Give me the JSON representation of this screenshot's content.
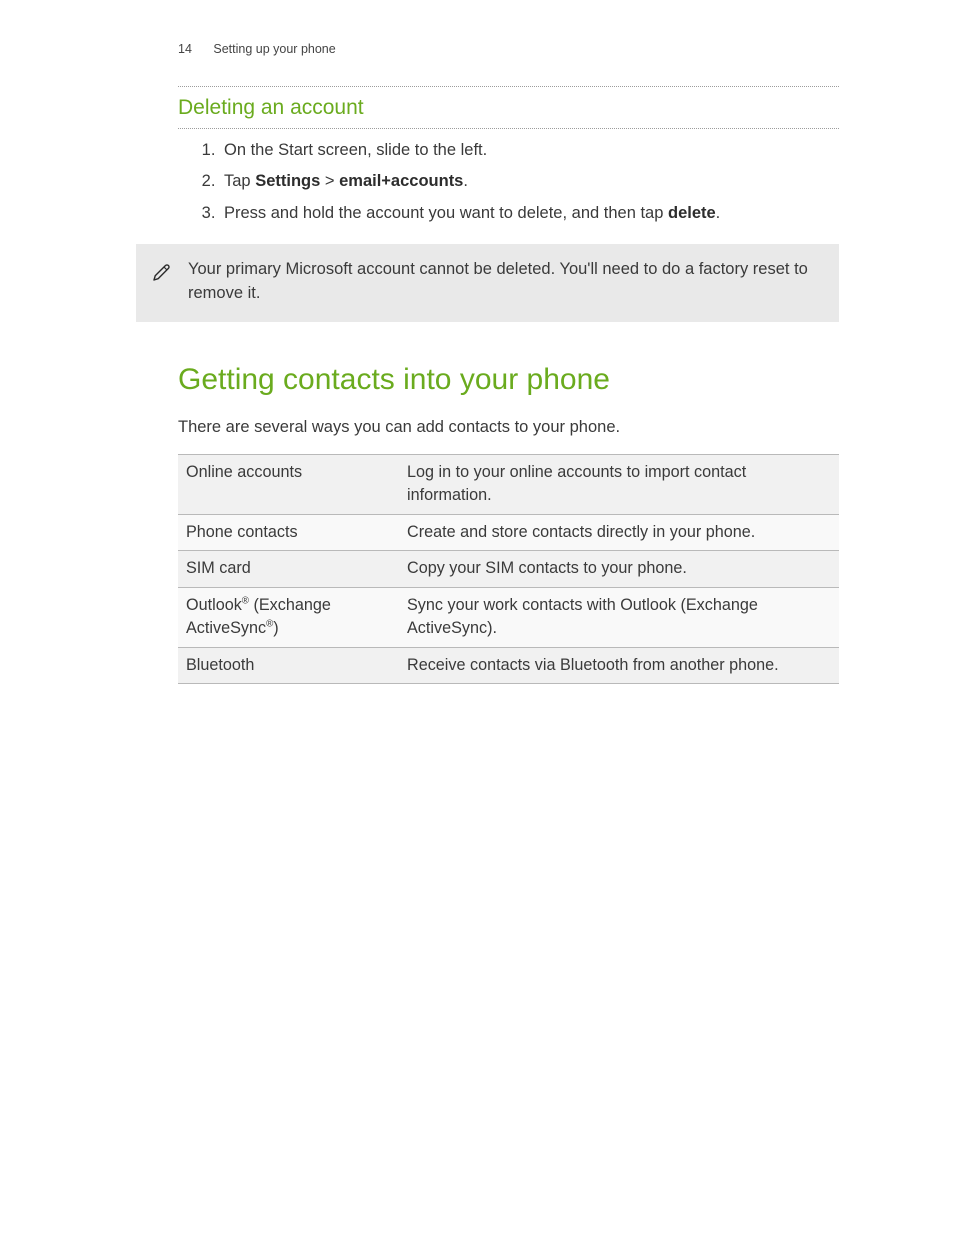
{
  "header": {
    "page_number": "14",
    "chapter": "Setting up your phone"
  },
  "section": {
    "title": "Deleting an account",
    "steps": {
      "s1": "On the Start screen, slide to the left.",
      "s2_pre": "Tap ",
      "s2_settings": "Settings",
      "s2_sep": " > ",
      "s2_email": "email+accounts",
      "s2_post": ".",
      "s3_pre": "Press and hold the account you want to delete, and then tap ",
      "s3_delete": "delete",
      "s3_post": "."
    }
  },
  "note": {
    "text": "Your primary Microsoft account cannot be deleted. You'll need to do a factory reset to remove it."
  },
  "main": {
    "title": "Getting contacts into your phone",
    "intro": "There are several ways you can add contacts to your phone.",
    "table": {
      "r0": {
        "left": "Online accounts",
        "right": "Log in to your online accounts to import contact information."
      },
      "r1": {
        "left": "Phone contacts",
        "right": "Create and store contacts directly in your phone."
      },
      "r2": {
        "left": "SIM card",
        "right": "Copy your SIM contacts to your phone."
      },
      "r3": {
        "left_a": "Outlook",
        "left_b": " (Exchange ActiveSync",
        "left_c": ")",
        "right": "Sync your work contacts with Outlook (Exchange ActiveSync)."
      },
      "r4": {
        "left": "Bluetooth",
        "right": "Receive contacts via Bluetooth from another phone."
      }
    }
  }
}
